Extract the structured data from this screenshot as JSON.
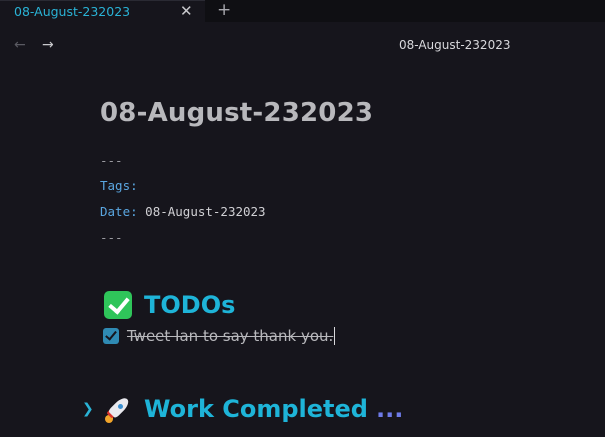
{
  "tabs": [
    {
      "title": "08-August-232023",
      "active": true
    }
  ],
  "tabbar": {
    "close_glyph": "✕",
    "new_tab_glyph": "+"
  },
  "nav": {
    "back_icon": "arrow-left-icon",
    "forward_icon": "arrow-right-icon",
    "title": "08-August-232023"
  },
  "page": {
    "title": "08-August-232023",
    "frontmatter": {
      "open": "---",
      "tags_key": "Tags:",
      "tags_value": "",
      "date_key": "Date:",
      "date_value": "08-August-232023",
      "close": "---"
    },
    "todos_heading": "TODOs",
    "todo_items": [
      {
        "text": "Tweet Ian to say thank you.",
        "checked": true
      }
    ],
    "work_heading": "Work Completed",
    "work_ellipsis": "..."
  },
  "colors": {
    "background": "#16151c",
    "heading_accent": "#1eb4d8",
    "frontmatter_key": "#5aa6e0",
    "checkbox": "#2f8ab3"
  }
}
